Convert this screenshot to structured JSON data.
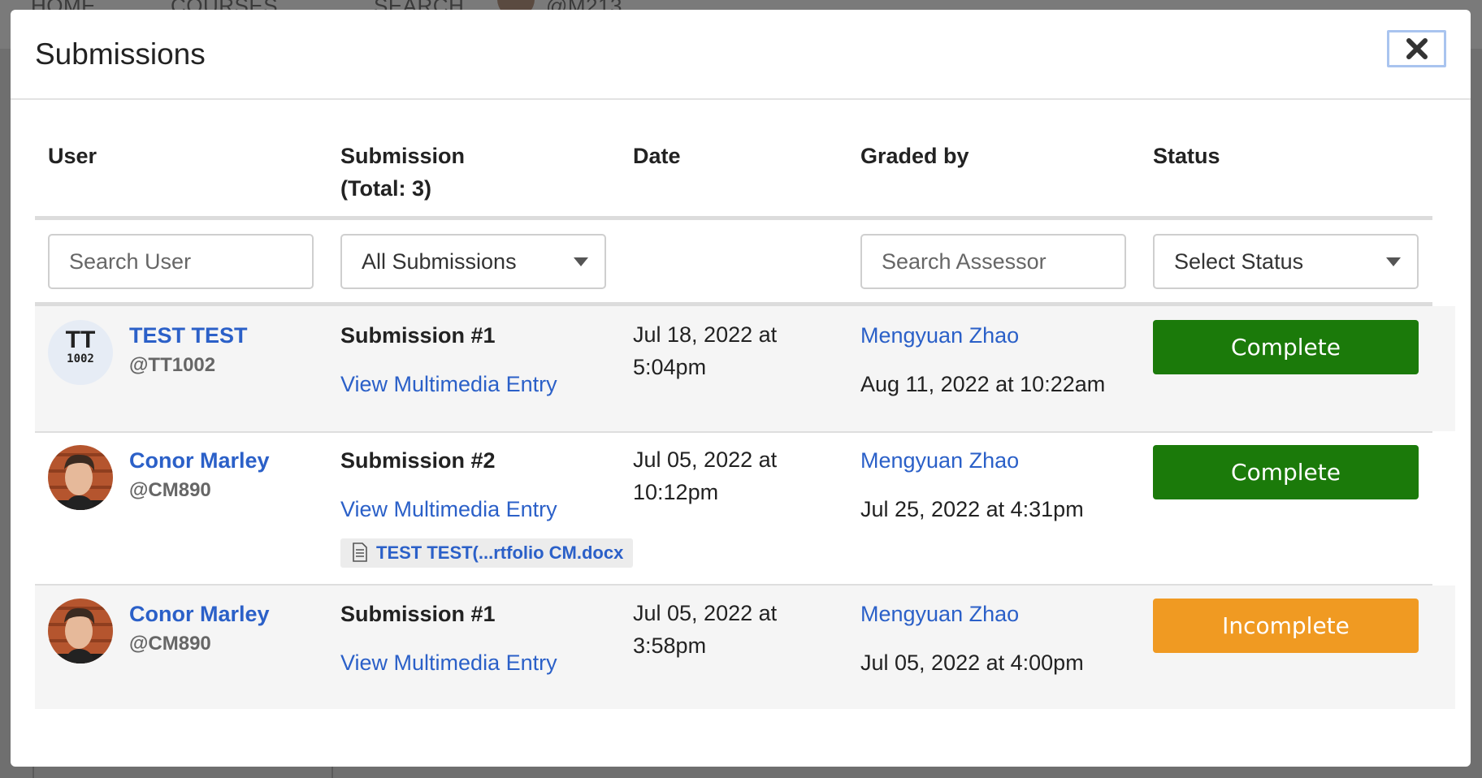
{
  "background": {
    "nav": [
      "HOME",
      "COURSES",
      "SEARCH",
      "@M213"
    ]
  },
  "modal": {
    "title": "Submissions",
    "close_icon": "close-icon"
  },
  "table": {
    "headers": {
      "user": "User",
      "submission_line1": "Submission",
      "submission_line2": "(Total: 3)",
      "date": "Date",
      "graded_by": "Graded by",
      "status": "Status"
    },
    "filters": {
      "user_placeholder": "Search User",
      "submission_selected": "All Submissions",
      "assessor_placeholder": "Search Assessor",
      "status_selected": "Select Status"
    },
    "rows": [
      {
        "avatar_initials": "TT",
        "avatar_sub": "1002",
        "name": "TEST TEST",
        "handle": "@TT1002",
        "submission": "Submission #1",
        "link": "View Multimedia Entry",
        "date_line1": "Jul 18, 2022 at",
        "date_line2": "5:04pm",
        "grader": "Mengyuan Zhao",
        "graded_date": "Aug 11, 2022 at 10:22am",
        "status": "Complete"
      },
      {
        "name": "Conor Marley",
        "handle": "@CM890",
        "submission": "Submission #2",
        "link": "View Multimedia Entry",
        "file": "TEST TEST(...rtfolio CM.docx",
        "date_line1": "Jul 05, 2022 at",
        "date_line2": "10:12pm",
        "grader": "Mengyuan Zhao",
        "graded_date": "Jul 25, 2022 at 4:31pm",
        "status": "Complete"
      },
      {
        "name": "Conor Marley",
        "handle": "@CM890",
        "submission": "Submission #1",
        "link": "View Multimedia Entry",
        "date_line1": "Jul 05, 2022 at",
        "date_line2": "3:58pm",
        "grader": "Mengyuan Zhao",
        "graded_date": "Jul 05, 2022 at 4:00pm",
        "status": "Incomplete"
      }
    ]
  },
  "colors": {
    "link": "#2b60c8",
    "complete": "#1b7a0a",
    "incomplete": "#f09a22"
  }
}
